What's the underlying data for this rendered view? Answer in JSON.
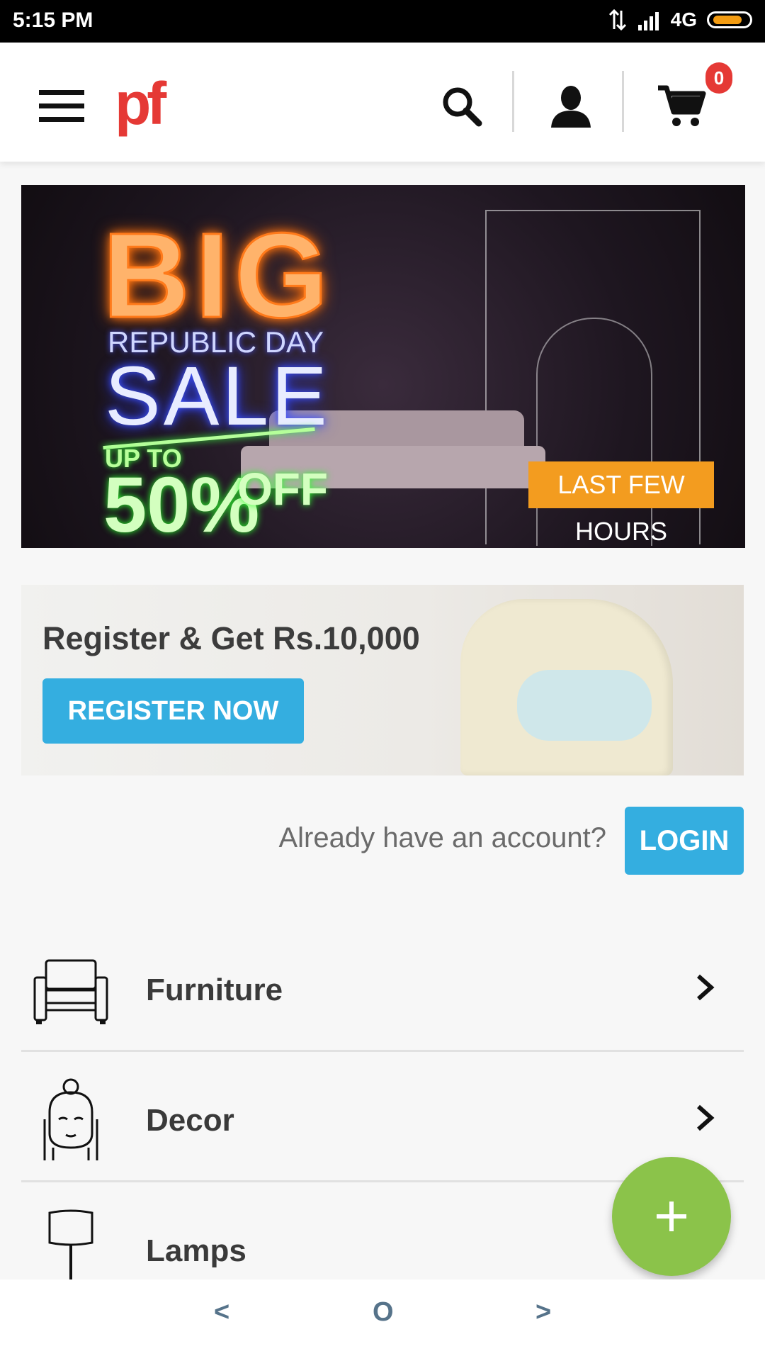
{
  "status_bar": {
    "time": "5:15 PM",
    "network": "4G"
  },
  "header": {
    "logo": "pf",
    "cart_count": "0"
  },
  "hero_banner": {
    "line1": "BIG",
    "line2": "REPUBLIC DAY",
    "line3": "SALE",
    "upto": "UP TO",
    "percent": "50%",
    "off": "OFF",
    "tag": "LAST FEW HOURS"
  },
  "promo": {
    "title": "Register & Get Rs.10,000",
    "button": "REGISTER NOW"
  },
  "login": {
    "question": "Already have an account?",
    "button": "LOGIN"
  },
  "categories": [
    {
      "label": "Furniture"
    },
    {
      "label": "Decor"
    },
    {
      "label": "Lamps"
    }
  ],
  "nav": {
    "back": "<",
    "home": "O",
    "forward": ">"
  },
  "colors": {
    "brand": "#e53935",
    "accent": "#34aee0",
    "fab": "#8bc34a",
    "tag": "#f39c1f"
  }
}
